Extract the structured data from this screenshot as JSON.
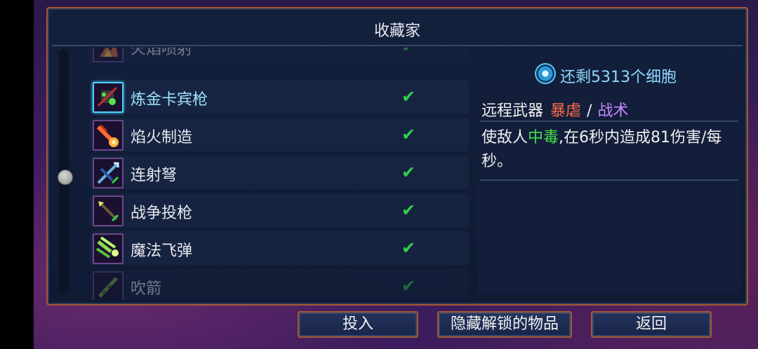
{
  "panel": {
    "title": "收藏家"
  },
  "items": [
    {
      "name": "火焰喷射",
      "checked": "✔",
      "state": "faded",
      "icon": "flamethrower-icon"
    },
    {
      "name": "炼金卡宾枪",
      "checked": "✔",
      "state": "selected",
      "icon": "alchemic-carbine-icon"
    },
    {
      "name": "焰火制造",
      "checked": "✔",
      "state": "normal",
      "icon": "fire-blast-icon"
    },
    {
      "name": "连射弩",
      "checked": "✔",
      "state": "normal",
      "icon": "repeater-crossbow-icon"
    },
    {
      "name": "战争投枪",
      "checked": "✔",
      "state": "normal",
      "icon": "war-javelin-icon"
    },
    {
      "name": "魔法飞弹",
      "checked": "✔",
      "state": "normal",
      "icon": "magic-missiles-icon"
    },
    {
      "name": "吹箭",
      "checked": "✔",
      "state": "faded",
      "icon": "blowgun-icon"
    }
  ],
  "cells": {
    "text": "还剩5313个细胞",
    "icon": "cell-icon"
  },
  "detail": {
    "type": "远程武器",
    "tag_brutality": "暴虐",
    "separator": "/",
    "tag_tactics": "战术",
    "desc_prefix": "使敌人",
    "desc_poison": "中毒",
    "desc_suffix": ",在6秒内造成81伤害/每秒。"
  },
  "buttons": {
    "invest": "投入",
    "hide_unlocked": "隐藏解锁的物品",
    "back": "返回"
  },
  "colors": {
    "accent_border": "#a55a34",
    "check": "#2fd04a",
    "brutality": "#ff6a4a",
    "tactics": "#c48aff",
    "poison": "#46e04a",
    "cells": "#8fd8ff"
  }
}
